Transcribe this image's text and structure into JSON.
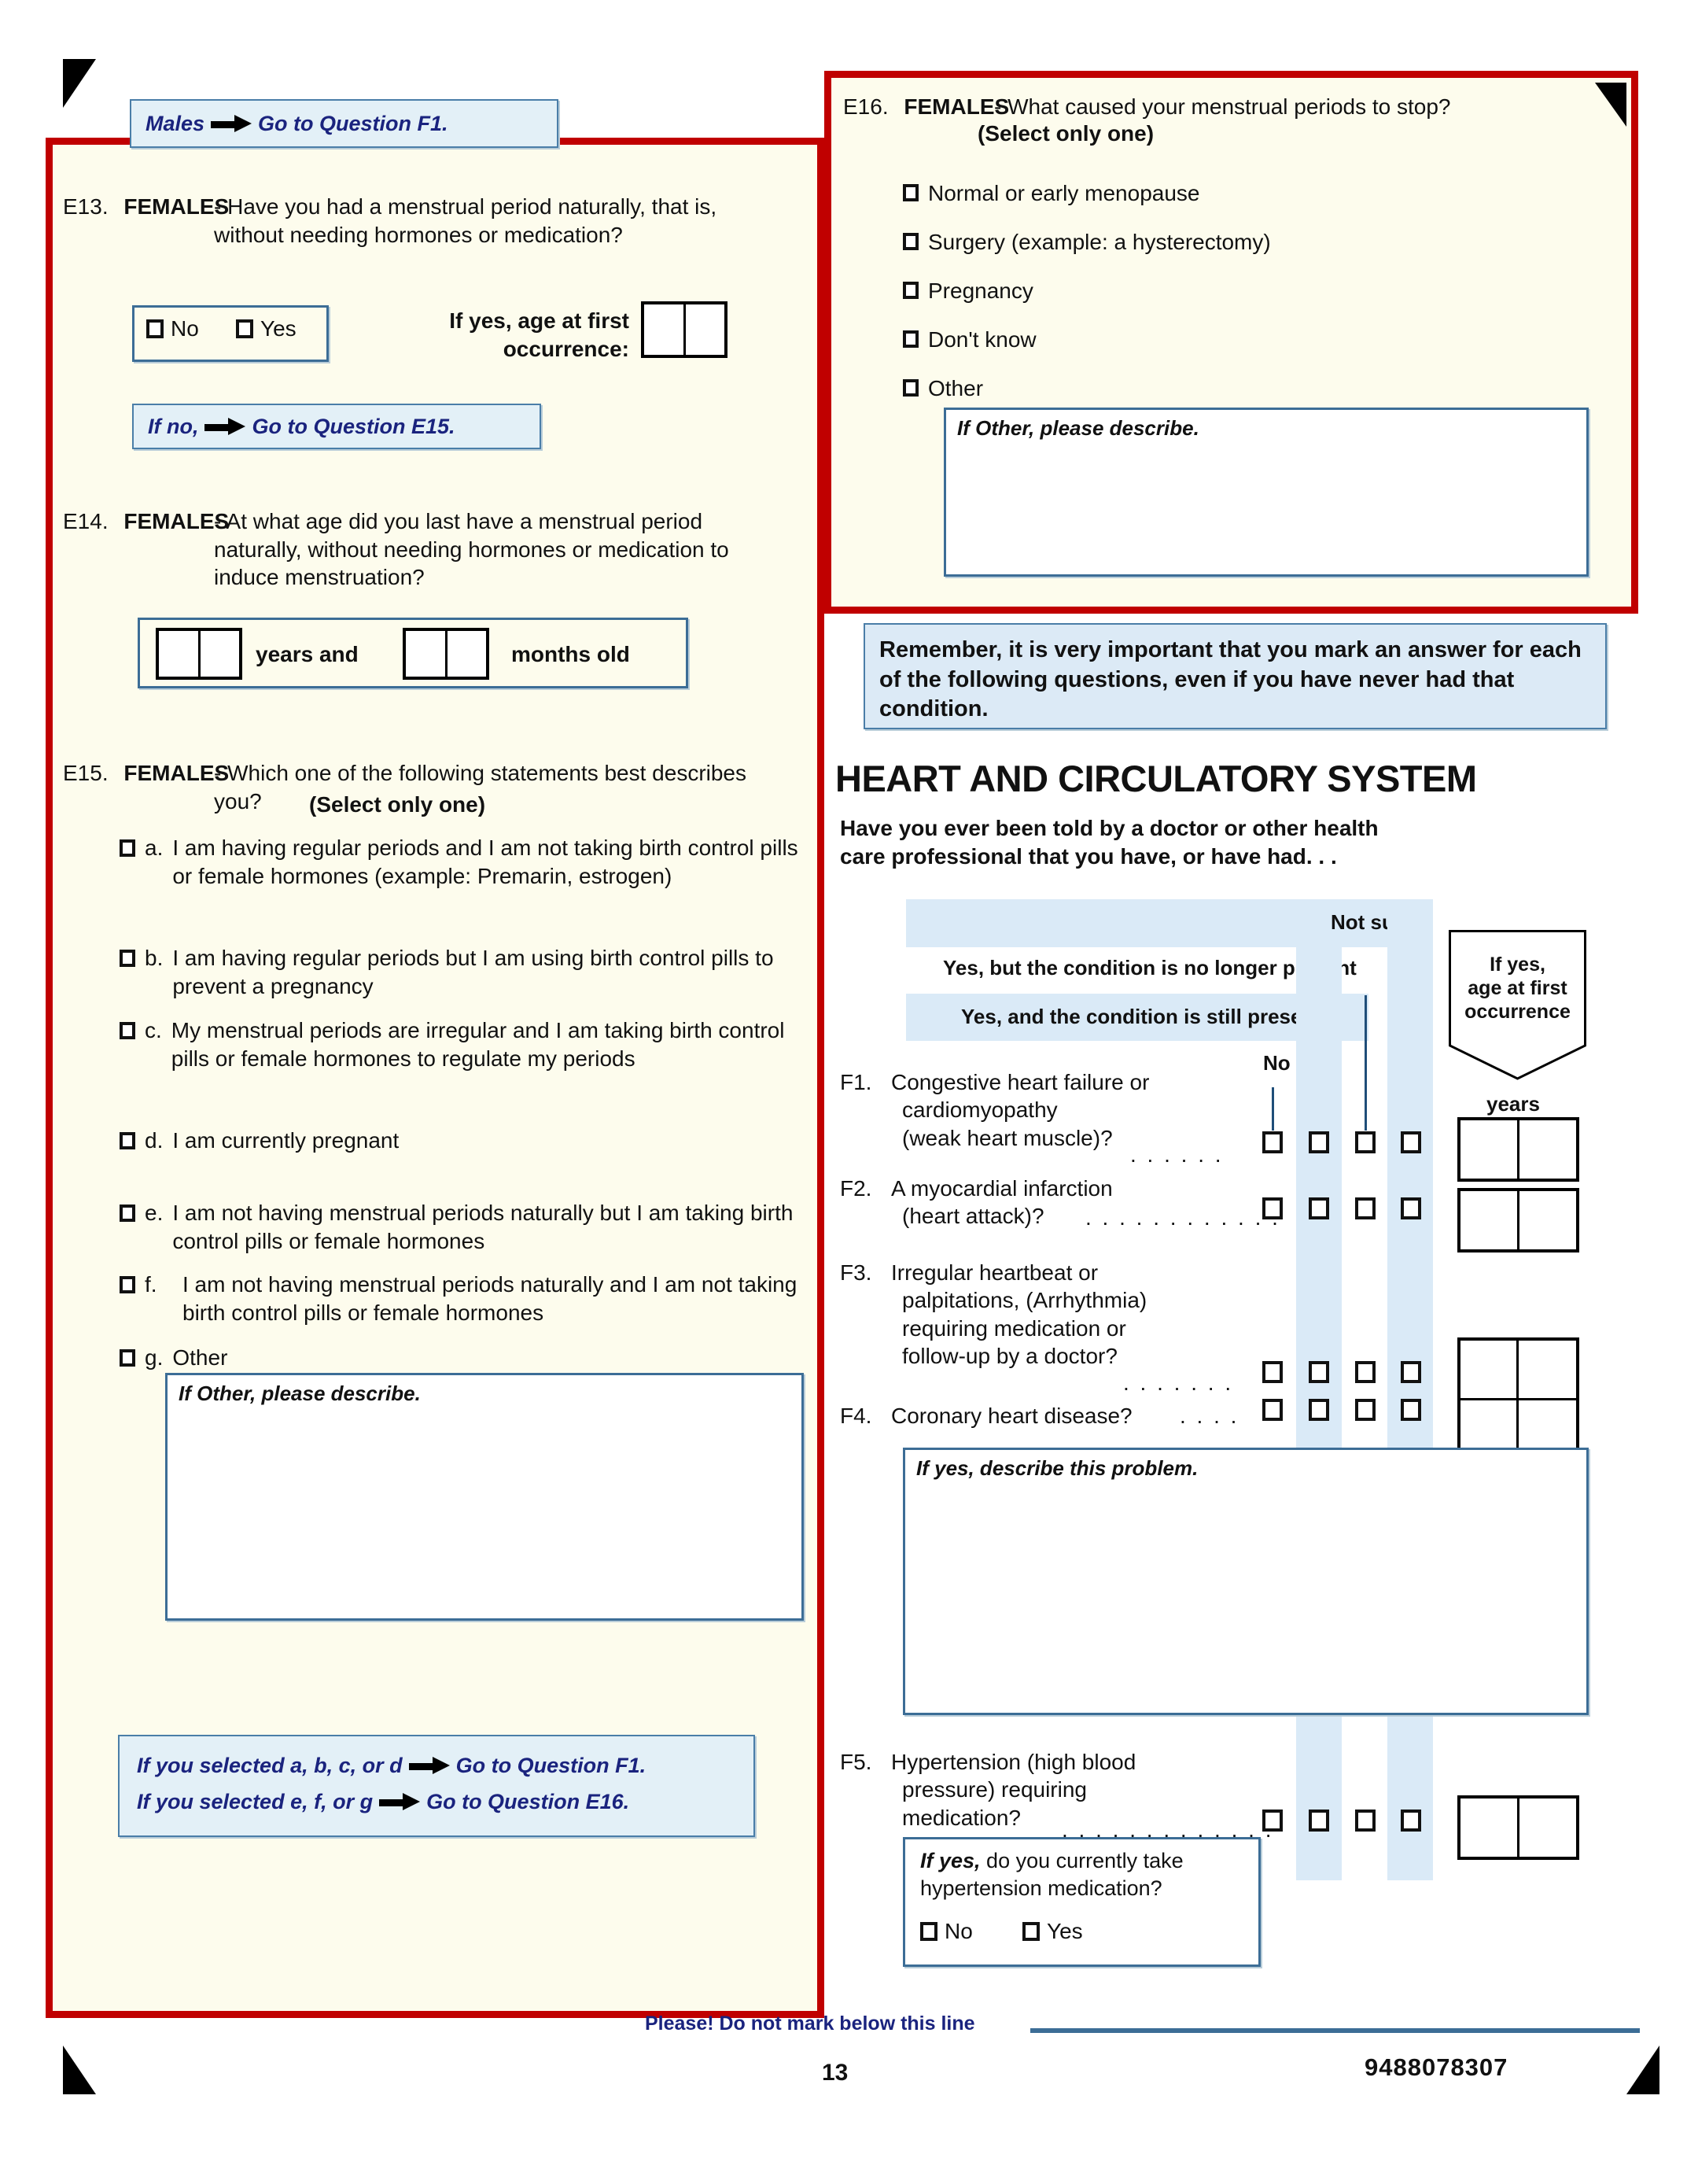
{
  "page": {
    "number": "13",
    "barcode": "9488078307",
    "footer_note": "Please! Do not mark below this line"
  },
  "left_column": {
    "males_skip": {
      "label": "Males",
      "target": "Go to Question F1."
    },
    "e13": {
      "number": "E13.",
      "audience": "FEMALES",
      "text": "- Have you had a menstrual period naturally, that is, without needing hormones or medication?",
      "no_label": "No",
      "yes_label": "Yes",
      "age_prompt_line1": "If yes, age at first",
      "age_prompt_line2": "occurrence:",
      "skip": {
        "condition": "If no,",
        "target": "Go to Question E15."
      }
    },
    "e14": {
      "number": "E14.",
      "audience": "FEMALES",
      "text": "- At what age did you last have a menstrual period naturally, without needing hormones or medication to induce menstruation?",
      "years_label": "years and",
      "months_label": "months old"
    },
    "e15": {
      "number": "E15.",
      "audience": "FEMALES",
      "text": "- Which one of the following statements best describes you?",
      "select_note": "(Select only one)",
      "options": [
        {
          "letter": "a.",
          "text": "I am having regular periods and I am not taking birth control pills or female hormones (example: Premarin, estrogen)"
        },
        {
          "letter": "b.",
          "text": "I am having regular periods but I am using birth control pills to prevent a pregnancy"
        },
        {
          "letter": "c.",
          "text": "My menstrual periods are irregular and I am taking birth control pills or female hormones to regulate my periods"
        },
        {
          "letter": "d.",
          "text": "I am currently pregnant"
        },
        {
          "letter": "e.",
          "text": "I am not having menstrual periods naturally but I am taking birth control pills or female hormones"
        },
        {
          "letter": "f.",
          "text": "I am not having menstrual periods naturally and I am not taking birth control pills or female hormones"
        },
        {
          "letter": "g.",
          "text": "Other"
        }
      ],
      "other_hint": "If Other, please describe.",
      "skips": [
        {
          "condition": "If you selected a, b, c, or d",
          "target": "Go to Question F1."
        },
        {
          "condition": "If you selected e, f, or g",
          "target": "Go to Question E16."
        }
      ]
    }
  },
  "right_column": {
    "e16": {
      "number": "E16.",
      "audience": "FEMALES",
      "text": "- What caused your menstrual periods to stop?",
      "select_note": "(Select only one)",
      "options": [
        "Normal or early menopause",
        "Surgery (example: a hysterectomy)",
        "Pregnancy",
        "Don't know",
        "Other"
      ],
      "other_hint": "If Other, please describe."
    },
    "remember": "Remember, it is very important that you mark an answer for each of the following questions, even if you have never had that condition.",
    "heart_section": {
      "title": "HEART AND CIRCULATORY SYSTEM",
      "lead_in_line1": "Have you ever been told by a doctor or other health",
      "lead_in_line2": "care professional that you have, or have had. . .",
      "column_headers": [
        "No",
        "Yes, and the condition is still present",
        "Yes, but the condition is no longer present",
        "Not sure"
      ],
      "age_header_line1": "If yes,",
      "age_header_line2": "age at first",
      "age_header_line3": "occurrence",
      "age_units": "years",
      "questions": [
        {
          "number": "F1.",
          "lines": [
            "Congestive heart failure or",
            "cardiomyopathy",
            "(weak heart muscle)?"
          ],
          "dots": ". . . . . ."
        },
        {
          "number": "F2.",
          "lines": [
            "A myocardial infarction",
            "(heart attack)?"
          ],
          "dots": ". . . . . . . . . . . ."
        },
        {
          "number": "F3.",
          "lines": [
            "Irregular heartbeat or",
            "palpitations, (Arrhythmia)",
            "requiring medication or",
            "follow-up by a doctor?"
          ],
          "dots": ". . . . . . ."
        },
        {
          "number": "F4.",
          "lines": [
            "Coronary heart disease?"
          ],
          "dots": ". . . ."
        },
        {
          "number": "F5.",
          "lines": [
            "Hypertension (high blood",
            "pressure) requiring",
            "medication?"
          ],
          "dots": ". . . . . . . . . . . . ."
        }
      ],
      "describe_hint": "If yes, describe this problem.",
      "f5_followup": {
        "prefix": "If yes,",
        "text": " do you currently take hypertension medication?",
        "no_label": "No",
        "yes_label": "Yes"
      }
    }
  },
  "colors": {
    "highlight_red": "#c00000",
    "skip_blue": "#1a237e",
    "band_blue": "#daeaf7",
    "paper_cream": "#fdfced"
  }
}
